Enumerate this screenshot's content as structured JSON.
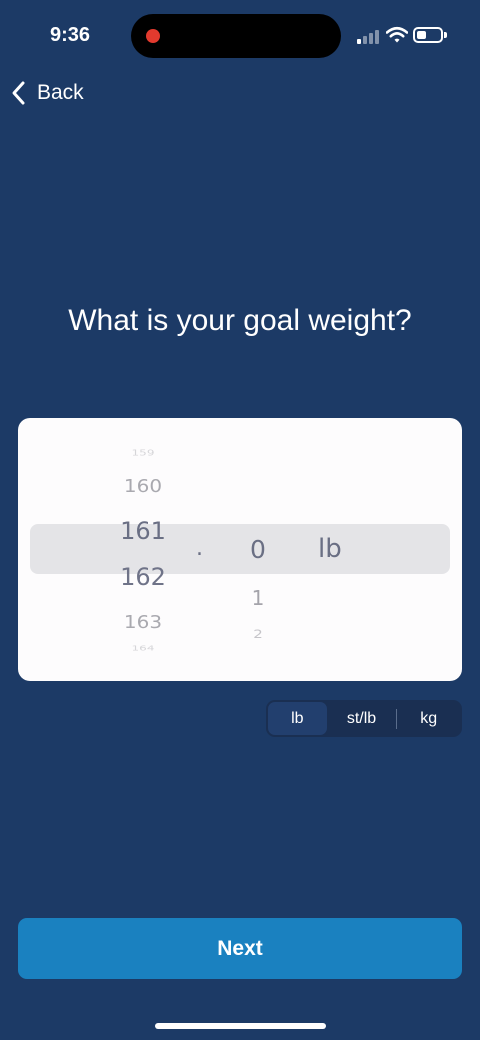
{
  "status_bar": {
    "time": "9:36"
  },
  "nav": {
    "back_label": "Back"
  },
  "question": "What is your goal weight?",
  "picker": {
    "integer_values": [
      "159",
      "160",
      "161",
      "162",
      "163",
      "164"
    ],
    "selected_integer": "161",
    "separator": ".",
    "decimal_values": [
      "0",
      "1",
      "2"
    ],
    "selected_decimal": "0",
    "unit": "lb"
  },
  "unit_options": [
    "lb",
    "st/lb",
    "kg"
  ],
  "selected_unit": "lb",
  "next_label": "Next",
  "colors": {
    "background": "#1c3a66",
    "primary_button": "#1a81c0",
    "recording_dot": "#e23a2e"
  }
}
